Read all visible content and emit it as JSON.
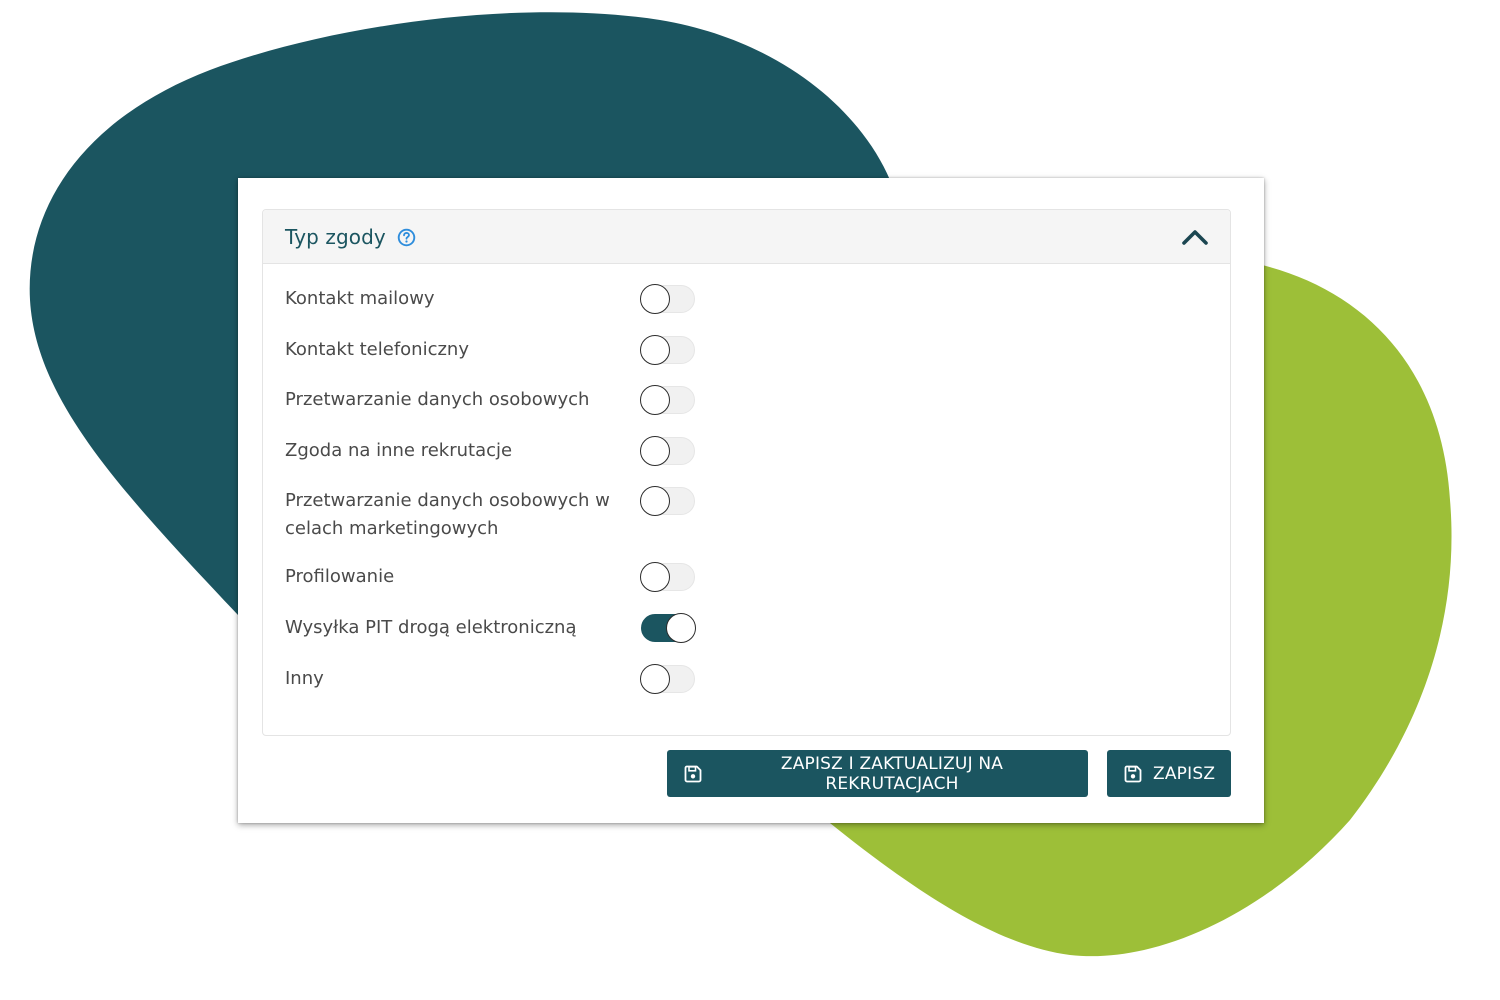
{
  "colors": {
    "accent": "#1b5560",
    "secondary_blob": "#9dbf38",
    "help_icon": "#2e8ddc",
    "label_text": "#4a4a4a"
  },
  "panel": {
    "title": "Typ zgody",
    "help_icon": "question-circle-icon",
    "collapse_icon": "chevron-up-icon"
  },
  "consents": [
    {
      "label": "Kontakt mailowy",
      "enabled": false
    },
    {
      "label": "Kontakt telefoniczny",
      "enabled": false
    },
    {
      "label": "Przetwarzanie danych osobowych",
      "enabled": false
    },
    {
      "label": "Zgoda na inne rekrutacje",
      "enabled": false
    },
    {
      "label": "Przetwarzanie danych osobowych w celach marketingowych",
      "enabled": false
    },
    {
      "label": "Profilowanie",
      "enabled": false
    },
    {
      "label": "Wysyłka PIT drogą elektroniczną",
      "enabled": true
    },
    {
      "label": "Inny",
      "enabled": false
    }
  ],
  "actions": {
    "save_and_update_label": "ZAPISZ I ZAKTUALIZUJ NA REKRUTACJACH",
    "save_label": "ZAPISZ",
    "save_icon": "floppy-disk-icon"
  }
}
